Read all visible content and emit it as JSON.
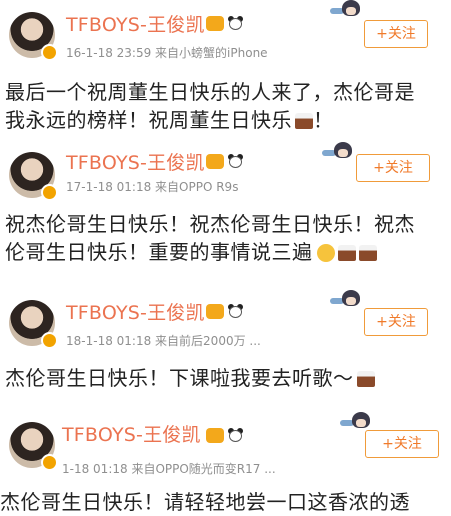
{
  "colors": {
    "username": "#eb7350",
    "meta": "#8f8f8f",
    "follow_border": "#f09b3a",
    "follow_text": "#f07a2a",
    "text": "#222222"
  },
  "follow_label": "+关注",
  "posts": [
    {
      "username": "TFBOYS-王俊凯",
      "meta": "16-1-18 23:59  来自小螃蟹的iPhone",
      "lines": [
        "最后一个祝周董生日快乐的人来了，杰伦哥是",
        "我永远的榜样！祝周董生日快乐",
        "！"
      ],
      "emoji": [
        "cake-icon"
      ]
    },
    {
      "username": "TFBOYS-王俊凯",
      "meta": "17-1-18 01:18  来自OPPO R9s",
      "lines": [
        "祝杰伦哥生日快乐！祝杰伦哥生日快乐！祝杰",
        "伦哥生日快乐！重要的事情说三遍"
      ],
      "emoji": [
        "smiley-icon",
        "cake-icon",
        "cake-icon"
      ]
    },
    {
      "username": "TFBOYS-王俊凯",
      "meta": "18-1-18 01:18  来自前后2000万 ...",
      "lines": [
        "杰伦哥生日快乐！下课啦我要去听歌～"
      ],
      "emoji": [
        "cake-icon"
      ]
    },
    {
      "username": "TFBOYS-王俊凯",
      "meta": "1-18 01:18  来自OPPO随光而变R17 ...",
      "lines": [
        "杰伦哥生日快乐！请轻轻地尝一口这香浓的透"
      ],
      "emoji": []
    }
  ]
}
